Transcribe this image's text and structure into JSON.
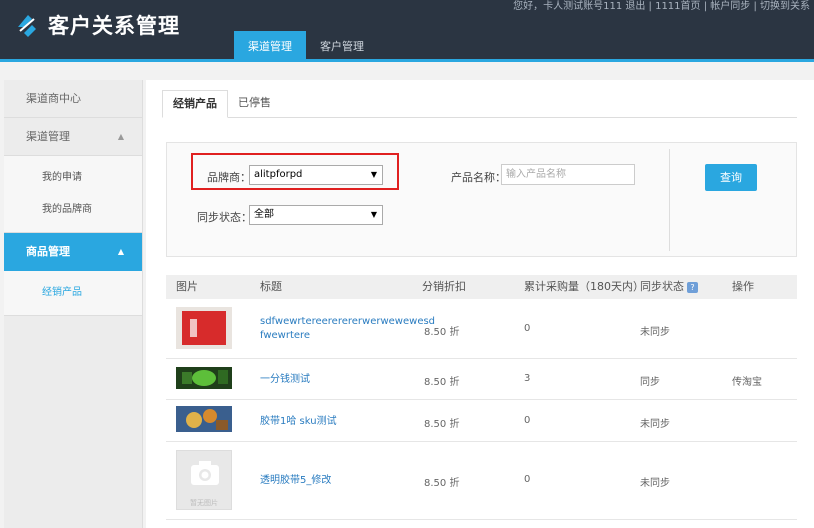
{
  "app": {
    "title": "客户关系管理",
    "top_links": "您好，卡人测试账号111 退出 | 1111首页 | 帐户同步 | 切换到关系",
    "logout_label": "切换到关系"
  },
  "nav": {
    "tabs": [
      {
        "label": "渠道管理"
      },
      {
        "label": "客户管理"
      }
    ]
  },
  "sidebar": {
    "items": [
      {
        "label": "渠道商中心"
      },
      {
        "label": "渠道管理"
      },
      {
        "label": "商品管理"
      }
    ],
    "sub_channel": [
      {
        "label": "我的申请"
      },
      {
        "label": "我的品牌商"
      }
    ],
    "sub_product": [
      {
        "label": "经销产品"
      }
    ]
  },
  "tabs": [
    {
      "label": "经销产品"
    },
    {
      "label": "已停售"
    }
  ],
  "filter": {
    "brand_label": "品牌商：",
    "brand_value": "alitpforpd",
    "product_label": "产品名称：",
    "product_placeholder": "输入产品名称",
    "sync_label": "同步状态：",
    "sync_value": "全部",
    "query_button": "查询"
  },
  "table": {
    "headers": [
      "图片",
      "标题",
      "分销折扣",
      "累计采购量（180天内）",
      "同步状态",
      "操作"
    ],
    "rows": [
      {
        "title_line1": "sdfwewrtereererererwerwewewesd",
        "title_line2": "fwewrtere",
        "discount": "8.50 折",
        "qty": "0",
        "status": "未同步",
        "action": ""
      },
      {
        "title_line1": "一分钱测试",
        "title_line2": "",
        "discount": "8.50 折",
        "qty": "3",
        "status": "同步",
        "action": "传淘宝"
      },
      {
        "title_line1": "胶带1哈 sku测试",
        "title_line2": "",
        "discount": "8.50 折",
        "qty": "0",
        "status": "未同步",
        "action": ""
      },
      {
        "title_line1": "透明胶带5_修改",
        "title_line2": "",
        "discount": "8.50 折",
        "qty": "0",
        "status": "未同步",
        "action": ""
      }
    ],
    "placeholder_caption": "暂无图片"
  },
  "colors": {
    "accent": "#2aa7e0",
    "header_bg": "#2b3542",
    "highlight": "#e02020"
  }
}
